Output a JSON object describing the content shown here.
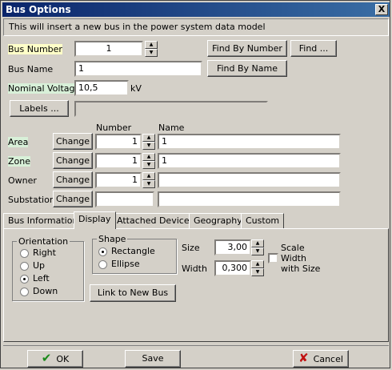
{
  "window": {
    "title": "Bus Options",
    "close": "X"
  },
  "info": "This will insert a new bus in the power system data model",
  "bus_number": {
    "label": "Bus Number",
    "value": "1"
  },
  "bus_name": {
    "label": "Bus Name",
    "value": "1"
  },
  "nominal_voltage": {
    "label": "Nominal Voltage",
    "value": "10,5",
    "unit": "kV"
  },
  "labels": {
    "button": "Labels ...",
    "value": ""
  },
  "find": {
    "by_number": "Find By Number",
    "generic": "Find ...",
    "by_name": "Find By Name"
  },
  "grid": {
    "col_number": "Number",
    "col_name": "Name",
    "change_label": "Change",
    "rows": [
      {
        "label": "Area",
        "number": "1",
        "name": "1"
      },
      {
        "label": "Zone",
        "number": "1",
        "name": "1"
      },
      {
        "label": "Owner",
        "number": "1",
        "name": ""
      },
      {
        "label": "Substation",
        "number": "",
        "name": ""
      }
    ]
  },
  "tabs": [
    "Bus Information",
    "Display",
    "Attached Devices",
    "Geography",
    "Custom"
  ],
  "active_tab": "Display",
  "display": {
    "orientation": {
      "caption": "Orientation",
      "options": [
        "Right",
        "Up",
        "Left",
        "Down"
      ],
      "selected": "Left"
    },
    "shape": {
      "caption": "Shape",
      "options": [
        "Rectangle",
        "Ellipse"
      ],
      "selected": "Rectangle"
    },
    "size": {
      "label": "Size",
      "value": "3,00"
    },
    "width": {
      "label": "Width",
      "value": "0,300"
    },
    "scale_width": {
      "label_line1": "Scale",
      "label_line2": "Width",
      "label_line3": "with Size",
      "checked": false
    },
    "link_button": "Link to New Bus"
  },
  "footer": {
    "ok": "OK",
    "save": "Save",
    "cancel": "Cancel"
  }
}
